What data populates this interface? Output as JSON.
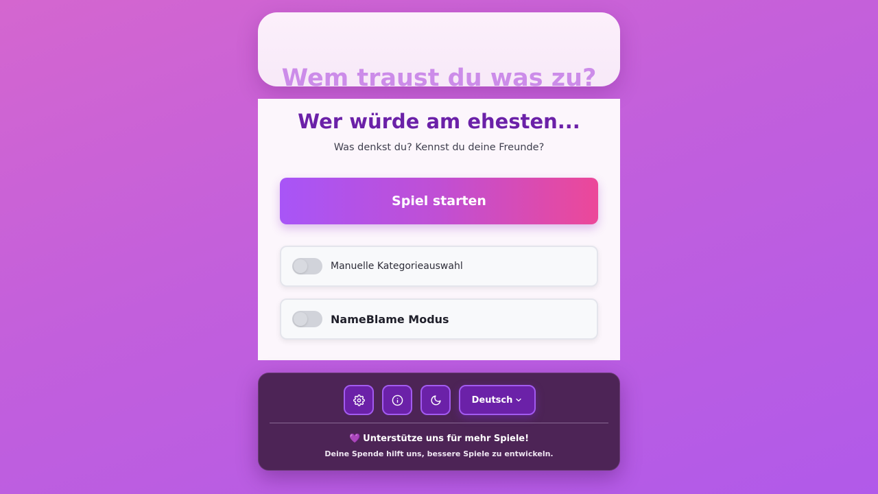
{
  "header": {
    "title": "Wem traust du was zu?"
  },
  "main": {
    "heading": "Wer würde am ehesten...",
    "subtitle": "Was denkst du? Kennst du deine Freunde?",
    "start_button_label": "Spiel starten",
    "toggles": [
      {
        "label": "Manuelle Kategorieauswahl",
        "checked": false
      },
      {
        "label": "NameBlame Modus",
        "checked": false
      }
    ]
  },
  "footer": {
    "icons": [
      "settings-icon",
      "info-icon",
      "moon-icon"
    ],
    "language_label": "Deutsch",
    "support_heart": "💜",
    "support_title": "Unterstütze uns für mehr Spiele!",
    "support_subtitle": "Deine Spende hilft uns, bessere Spiele zu entwickeln."
  },
  "colors": {
    "accent_purple": "#6b21a8",
    "gradient_start": "#a855f7",
    "gradient_end": "#ec4899",
    "footer_bg": "#4d2456"
  }
}
